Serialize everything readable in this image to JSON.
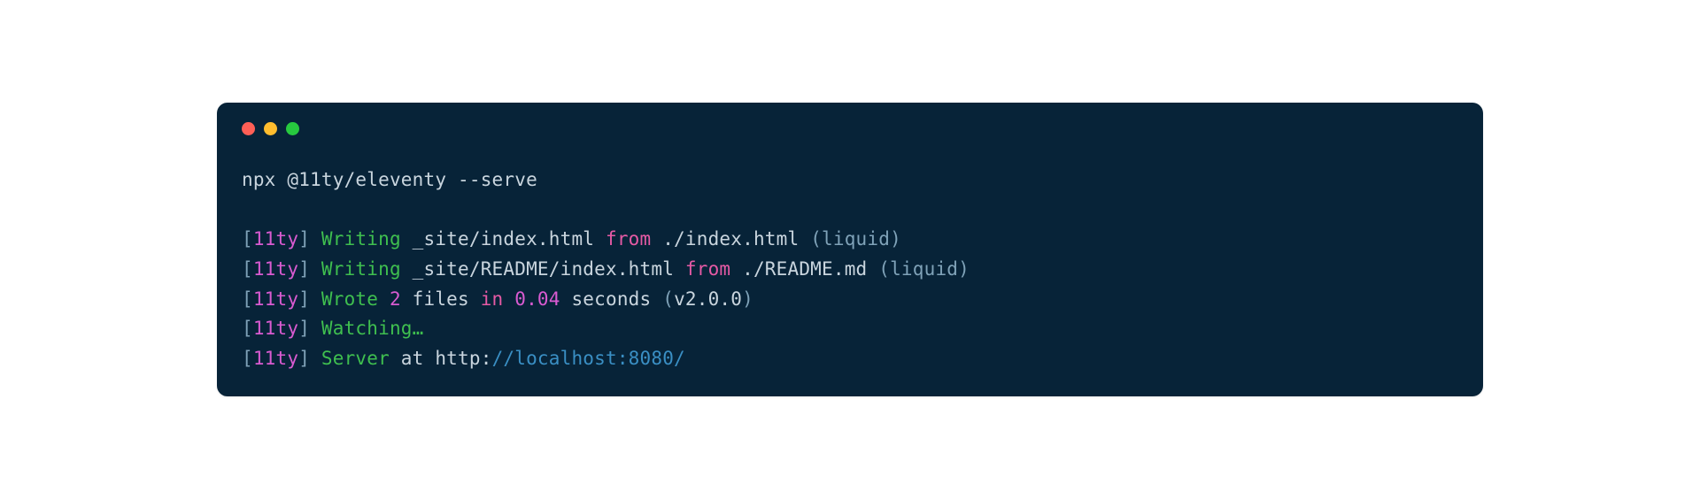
{
  "window": {
    "controls": {
      "close": "close",
      "minimize": "minimize",
      "maximize": "maximize"
    }
  },
  "terminal": {
    "command": "npx @11ty/eleventy --serve",
    "lines": [
      {
        "bracket_open": "[",
        "tag": "11ty",
        "bracket_close": "] ",
        "verb": "Writing",
        "sp1": " ",
        "path": "_site/index.html",
        "sp2": " ",
        "kw": "from",
        "sp3": " ",
        "source": "./index.html ",
        "paren": "(liquid)"
      },
      {
        "bracket_open": "[",
        "tag": "11ty",
        "bracket_close": "] ",
        "verb": "Writing",
        "sp1": " ",
        "path": "_site/README/index.html",
        "sp2": " ",
        "kw": "from",
        "sp3": " ",
        "source": "./README.md ",
        "paren": "(liquid)"
      },
      {
        "bracket_open": "[",
        "tag": "11ty",
        "bracket_close": "] ",
        "verb": "Wrote",
        "sp1": " ",
        "num1": "2",
        "word1": " files ",
        "kw": "in",
        "sp2": " ",
        "num2": "0.04",
        "word2": " seconds ",
        "paren_open": "(",
        "version": "v2.0.0",
        "paren_close": ")"
      },
      {
        "bracket_open": "[",
        "tag": "11ty",
        "bracket_close": "] ",
        "verb": "Watching…"
      },
      {
        "bracket_open": "[",
        "tag": "11ty",
        "bracket_close": "] ",
        "verb": "Server",
        "word1": " at ",
        "proto": "http:",
        "url": "//localhost:8080/"
      }
    ]
  }
}
